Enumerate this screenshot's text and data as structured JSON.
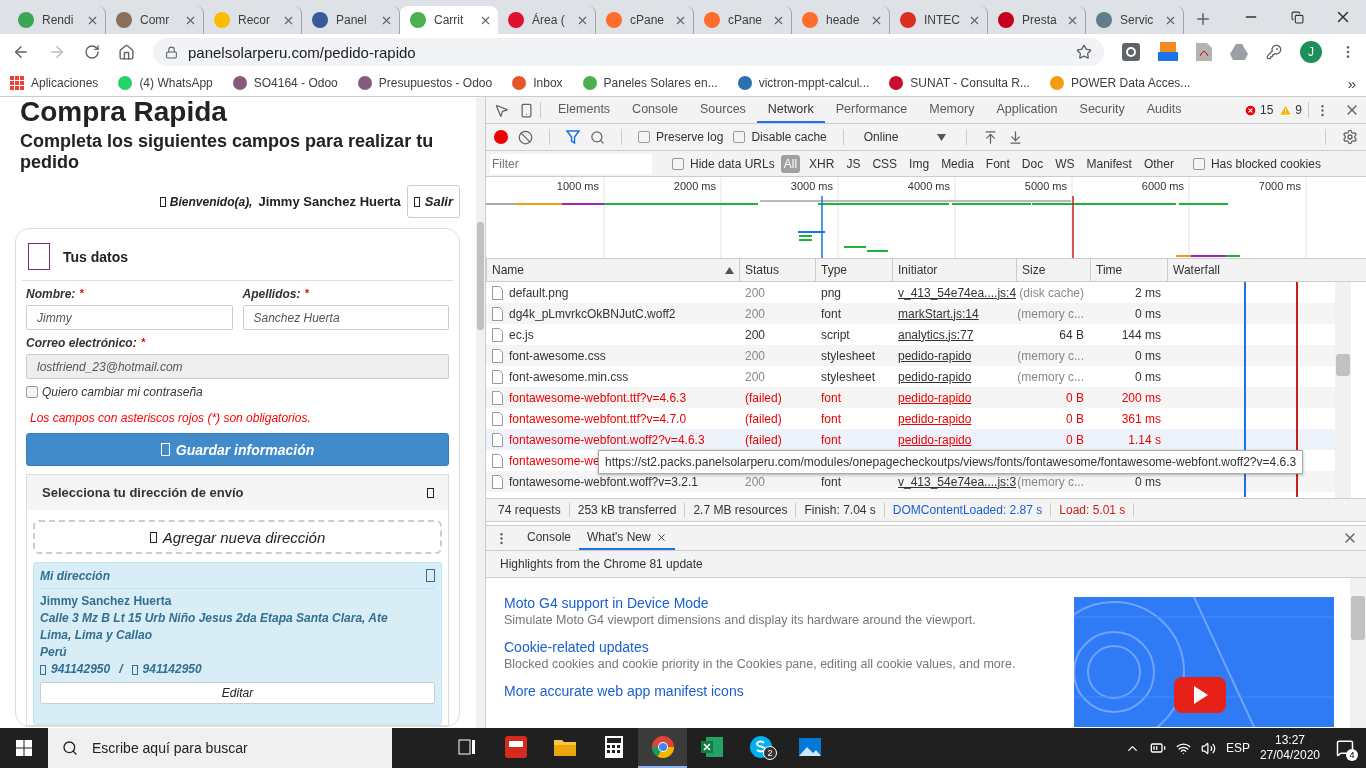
{
  "browser": {
    "tabs": [
      {
        "title": "Rendi",
        "color": "#3aa757",
        "selected": false
      },
      {
        "title": "Comr",
        "color": "#8a6d5a",
        "selected": false
      },
      {
        "title": "Recor",
        "color": "#fbbc04",
        "selected": false
      },
      {
        "title": "Panel",
        "color": "#3b5998",
        "selected": false
      },
      {
        "title": "Carrit",
        "color": "#4caf50",
        "selected": true
      },
      {
        "title": "Área (",
        "color": "#e0102f",
        "selected": false
      },
      {
        "title": "cPane",
        "color": "#ff6c2c",
        "selected": false
      },
      {
        "title": "cPane",
        "color": "#ff6c2c",
        "selected": false
      },
      {
        "title": "heade",
        "color": "#ff6c2c",
        "selected": false
      },
      {
        "title": "INTEC",
        "color": "#d93025",
        "selected": false
      },
      {
        "title": "Presta",
        "color": "#c4001a",
        "selected": false
      },
      {
        "title": "Servic",
        "color": "#607d8b",
        "selected": false
      }
    ],
    "address": "panelsolarperu.com/pedido-rapido",
    "profile_initial": "J",
    "bookmarks": [
      {
        "label": "Aplicaciones",
        "kind": "apps",
        "color": "#ea4335"
      },
      {
        "label": "(4) WhatsApp",
        "kind": "site",
        "color": "#25d366"
      },
      {
        "label": "SO4164 - Odoo",
        "kind": "site",
        "color": "#875a7b"
      },
      {
        "label": "Presupuestos - Odoo",
        "kind": "site",
        "color": "#875a7b"
      },
      {
        "label": "Inbox",
        "kind": "site",
        "color": "#e8552b"
      },
      {
        "label": "Paneles Solares en...",
        "kind": "site",
        "color": "#4caf50"
      },
      {
        "label": "victron-mppt-calcul...",
        "kind": "site",
        "color": "#2a6fb0"
      },
      {
        "label": "SUNAT - Consulta R...",
        "kind": "site",
        "color": "#c8102e"
      },
      {
        "label": "POWER Data Acces...",
        "kind": "site",
        "color": "#f39c12"
      }
    ],
    "bookmarks_more": "»"
  },
  "page": {
    "title": "Compra Rapida",
    "subtitle": "Completa los siguientes campos para realizar tu pedido",
    "welcome": "Bienvenido(a),",
    "user_name": "Jimmy Sanchez Huerta",
    "logout": "Salir",
    "personal": {
      "heading": "Tus datos",
      "fields": [
        {
          "label": "Nombre:",
          "required_mark": "*",
          "value": "Jimmy",
          "disabled": false,
          "kind": "half"
        },
        {
          "label": "Apellidos:",
          "required_mark": "*",
          "value": "Sanchez Huerta",
          "disabled": false,
          "kind": "half"
        },
        {
          "label": "Correo electrónico:",
          "required_mark": "*",
          "value": "lostfriend_23@hotmail.com",
          "disabled": true,
          "kind": "full"
        }
      ],
      "change_password": {
        "label": "Quiero cambiar mi contraseña",
        "checked": false
      },
      "notice": "Los campos con asteriscos rojos (*) son obligatorios.",
      "save": "Guardar información"
    },
    "shipping": {
      "heading": "Selecciona tu dirección de envío",
      "add": "Agregar nueva dirección",
      "address": {
        "title": "Mi dirección",
        "name": "Jimmy Sanchez Huerta",
        "lines": [
          "Calle 3 Mz B Lt 15 Urb Niño Jesus 2da Etapa Santa Clara, Ate",
          "Lima, Lima y Callao",
          "Perú"
        ],
        "phone": "941142950",
        "separator": "/",
        "mobile": "941142950",
        "edit": "Editar"
      }
    }
  },
  "devtools": {
    "panel_tabs": [
      {
        "label": "Elements",
        "selected": false
      },
      {
        "label": "Console",
        "selected": false
      },
      {
        "label": "Sources",
        "selected": false
      },
      {
        "label": "Network",
        "selected": true
      },
      {
        "label": "Performance",
        "selected": false
      },
      {
        "label": "Memory",
        "selected": false
      },
      {
        "label": "Application",
        "selected": false
      },
      {
        "label": "Security",
        "selected": false
      },
      {
        "label": "Audits",
        "selected": false
      }
    ],
    "errors": "15",
    "warnings": "9",
    "toolbar": {
      "recording": true,
      "checkboxes": [
        {
          "label": "Preserve log",
          "checked": false
        },
        {
          "label": "Disable cache",
          "checked": false
        }
      ],
      "throttling": "Online"
    },
    "filter": {
      "placeholder": "Filter",
      "hide_data_urls": {
        "label": "Hide data URLs",
        "checked": false
      },
      "types": [
        {
          "label": "All",
          "selected": true
        },
        {
          "label": "XHR",
          "selected": false
        },
        {
          "label": "JS",
          "selected": false
        },
        {
          "label": "CSS",
          "selected": false
        },
        {
          "label": "Img",
          "selected": false
        },
        {
          "label": "Media",
          "selected": false
        },
        {
          "label": "Font",
          "selected": false
        },
        {
          "label": "Doc",
          "selected": false
        },
        {
          "label": "WS",
          "selected": false
        },
        {
          "label": "Manifest",
          "selected": false
        },
        {
          "label": "Other",
          "selected": false
        }
      ],
      "blocked_cookies": {
        "label": "Has blocked cookies",
        "checked": false
      }
    },
    "overview": {
      "ticks": [
        "1000 ms",
        "2000 ms",
        "3000 ms",
        "4000 ms",
        "5000 ms",
        "6000 ms",
        "7000 ms"
      ]
    },
    "columns": [
      {
        "label": "Name",
        "sorted": true
      },
      {
        "label": "Status",
        "sorted": false
      },
      {
        "label": "Type",
        "sorted": false
      },
      {
        "label": "Initiator",
        "sorted": false
      },
      {
        "label": "Size",
        "sorted": false
      },
      {
        "label": "Time",
        "sorted": false
      },
      {
        "label": "Waterfall",
        "sorted": false
      }
    ],
    "rows": [
      {
        "name": "default.png",
        "status": "200",
        "type": "png",
        "initiator": "v_413_54e74ea....js:4",
        "size": "(disk cache)",
        "time": "2 ms",
        "failed": false,
        "cached": true,
        "hovered": false
      },
      {
        "name": "dg4k_pLmvrkcOkBNJutC.woff2",
        "status": "200",
        "type": "font",
        "initiator": "markStart.js:14",
        "size": "(memory c...",
        "time": "0 ms",
        "failed": false,
        "cached": true,
        "hovered": false
      },
      {
        "name": "ec.js",
        "status": "200",
        "type": "script",
        "initiator": "analytics.js:77",
        "size": "64 B",
        "time": "144 ms",
        "failed": false,
        "cached": false,
        "hovered": false
      },
      {
        "name": "font-awesome.css",
        "status": "200",
        "type": "stylesheet",
        "initiator": "pedido-rapido",
        "size": "(memory c...",
        "time": "0 ms",
        "failed": false,
        "cached": true,
        "hovered": false
      },
      {
        "name": "font-awesome.min.css",
        "status": "200",
        "type": "stylesheet",
        "initiator": "pedido-rapido",
        "size": "(memory c...",
        "time": "0 ms",
        "failed": false,
        "cached": true,
        "hovered": false
      },
      {
        "name": "fontawesome-webfont.ttf?v=4.6.3",
        "status": "(failed)",
        "type": "font",
        "initiator": "pedido-rapido",
        "size": "0 B",
        "time": "200 ms",
        "failed": true,
        "cached": false,
        "hovered": false
      },
      {
        "name": "fontawesome-webfont.ttf?v=4.7.0",
        "status": "(failed)",
        "type": "font",
        "initiator": "pedido-rapido",
        "size": "0 B",
        "time": "361 ms",
        "failed": true,
        "cached": false,
        "hovered": false
      },
      {
        "name": "fontawesome-webfont.woff2?v=4.6.3",
        "status": "(failed)",
        "type": "font",
        "initiator": "pedido-rapido",
        "size": "0 B",
        "time": "1.14 s",
        "failed": true,
        "cached": false,
        "hovered": true
      },
      {
        "name": "fontawesome-we",
        "failed": true,
        "hovered": false
      },
      {
        "name": "fontawesome-webfont.woff?v=3.2.1",
        "status": "200",
        "type": "font",
        "initiator": "v_413_54e74ea....js:3",
        "size": "(memory c...",
        "time": "0 ms",
        "failed": false,
        "cached": true,
        "hovered": false
      }
    ],
    "tooltip": "https://st2.packs.panelsolarperu.com/modules/onepagecheckoutps/views/fonts/fontawesome/fontawesome-webfont.woff2?v=4.6.3",
    "summary": [
      {
        "text": "74 requests",
        "color": "#333333"
      },
      {
        "text": "253 kB transferred",
        "color": "#333333"
      },
      {
        "text": "2.7 MB resources",
        "color": "#333333"
      },
      {
        "text": "Finish: 7.04 s",
        "color": "#333333"
      },
      {
        "text": "DOMContentLoaded: 2.87 s",
        "color": "#1a5fd0"
      },
      {
        "text": "Load: 5.01 s",
        "color": "#c5221f"
      }
    ],
    "drawer": {
      "tabs": [
        {
          "label": "Console",
          "selected": false,
          "closable": false
        },
        {
          "label": "What's New",
          "selected": true,
          "closable": true
        }
      ],
      "heading": "Highlights from the Chrome 81 update",
      "items": [
        {
          "title": "Moto G4 support in Device Mode",
          "description": "Simulate Moto G4 viewport dimensions and display its hardware around the viewport."
        },
        {
          "title": "Cookie-related updates",
          "description": "Blocked cookies and cookie priority in the Cookies pane, editing all cookie values, and more."
        },
        {
          "title": "More accurate web app manifest icons"
        }
      ]
    }
  },
  "taskbar": {
    "search_placeholder": "Escribe aquí para buscar",
    "apps": [
      {
        "kind": "taskview",
        "active": false
      },
      {
        "kind": "cad",
        "active": false
      },
      {
        "kind": "folder",
        "active": false
      },
      {
        "kind": "calculator",
        "active": false
      },
      {
        "kind": "browser",
        "active": true
      },
      {
        "kind": "spreadsheet",
        "active": false
      },
      {
        "kind": "chat",
        "active": false,
        "badge": "2"
      },
      {
        "kind": "photos",
        "active": false
      }
    ],
    "language": "ESP",
    "time": "13:27",
    "date": "27/04/2020",
    "notifications": "4"
  }
}
